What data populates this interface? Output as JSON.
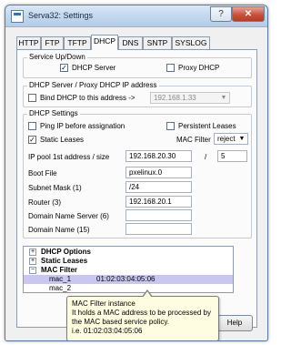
{
  "window": {
    "title": "Serva32: Settings",
    "help_glyph": "?",
    "close_glyph": "✕"
  },
  "tabs": [
    "HTTP",
    "FTP",
    "TFTP",
    "DHCP",
    "DNS",
    "SNTP",
    "SYSLOG"
  ],
  "active_tab": "DHCP",
  "service": {
    "legend": "Service Up/Down",
    "dhcp_server": {
      "label": "DHCP Server",
      "checked": true
    },
    "proxy_dhcp": {
      "label": "Proxy DHCP",
      "checked": false
    }
  },
  "bind": {
    "legend": "DHCP Server / Proxy DHCP IP address",
    "label": "Bind DHCP to this address ->",
    "checked": false,
    "address": "192.168.1.33"
  },
  "settings": {
    "legend": "DHCP Settings",
    "ping_ip": {
      "label": "Ping IP before assignation",
      "checked": false
    },
    "persistent_leases": {
      "label": "Persistent Leases",
      "checked": false
    },
    "static_leases": {
      "label": "Static Leases",
      "checked": true
    },
    "mac_filter_label": "MAC Filter",
    "mac_filter_value": "reject",
    "ip_pool_label": "IP pool 1st address / size",
    "ip_pool_address": "192.168.20.30",
    "ip_pool_sep": "/",
    "ip_pool_size": "5",
    "boot_file_label": "Boot File",
    "boot_file": "pxelinux.0",
    "subnet_mask_label": "Subnet Mask  (1)",
    "subnet_mask": "/24",
    "router_label": "Router  (3)",
    "router": "192.168.20.1",
    "dns_label": "Domain Name Server  (6)",
    "dns": "",
    "domain_name_label": "Domain Name  (15)",
    "domain_name": ""
  },
  "tree": {
    "items": [
      {
        "label": "DHCP Options",
        "expander": "+"
      },
      {
        "label": "Static Leases",
        "expander": "+"
      },
      {
        "label": "MAC Filter",
        "expander": "−"
      }
    ],
    "mac_rows": [
      {
        "name": "mac_1",
        "value": "01:02:03:04:05:06"
      },
      {
        "name": "mac_2",
        "value": ""
      }
    ]
  },
  "tooltip": {
    "lines": [
      "MAC Filter instance",
      "It holds a MAC address to be processed by",
      "the MAC based service policy.",
      "i.e. 01:02:03:04:05:06"
    ]
  },
  "help_button": "Help",
  "colors": {
    "selection": "#c9c7f2",
    "tooltip_bg": "#fffde1"
  }
}
